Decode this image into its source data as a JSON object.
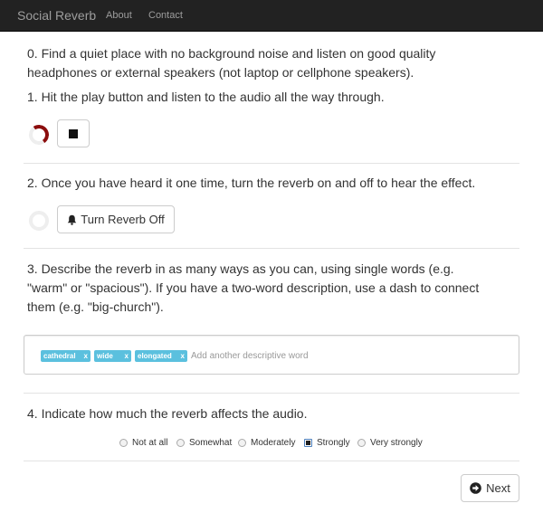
{
  "navbar": {
    "brand": "Social Reverb",
    "links": [
      "About",
      "Contact"
    ]
  },
  "steps": {
    "step0": {
      "line1": "0. Find a quiet place with no background noise and listen on good quality",
      "line2": "headphones or external speakers (not laptop or cellphone speakers)."
    },
    "step1": {
      "text": "1. Hit the play button and listen to the audio all the way through."
    },
    "step2": {
      "text": "2. Once you have heard it one time, turn the reverb on and off to hear the effect."
    },
    "step3": {
      "line1": "3. Describe the reverb in as many ways as you can, using single words (e.g.",
      "line2": "\"warm\" or \"spacious\"). If you have a two-word description, use a dash to connect",
      "line3": "them (e.g. \"big-church\")."
    },
    "step4": {
      "text": "4. Indicate how much the reverb affects the audio."
    }
  },
  "player": {
    "spinner_icon": "loading-spinner",
    "stop_icon": "stop-square-icon"
  },
  "reverb_toggle": {
    "label": "Turn Reverb Off",
    "icon": "bell-icon"
  },
  "descriptors": {
    "tags": [
      "cathedral",
      "wide",
      "elongated"
    ],
    "remove_glyph": "x",
    "placeholder": "Add another descriptive word",
    "tag_color": "#5bc0de"
  },
  "effect_rating": {
    "options": [
      "Not at all",
      "Somewhat",
      "Moderately",
      "Strongly",
      "Very strongly"
    ],
    "selected": "Strongly"
  },
  "next_button": {
    "label": "Next",
    "icon": "arrow-circle-right-icon"
  }
}
